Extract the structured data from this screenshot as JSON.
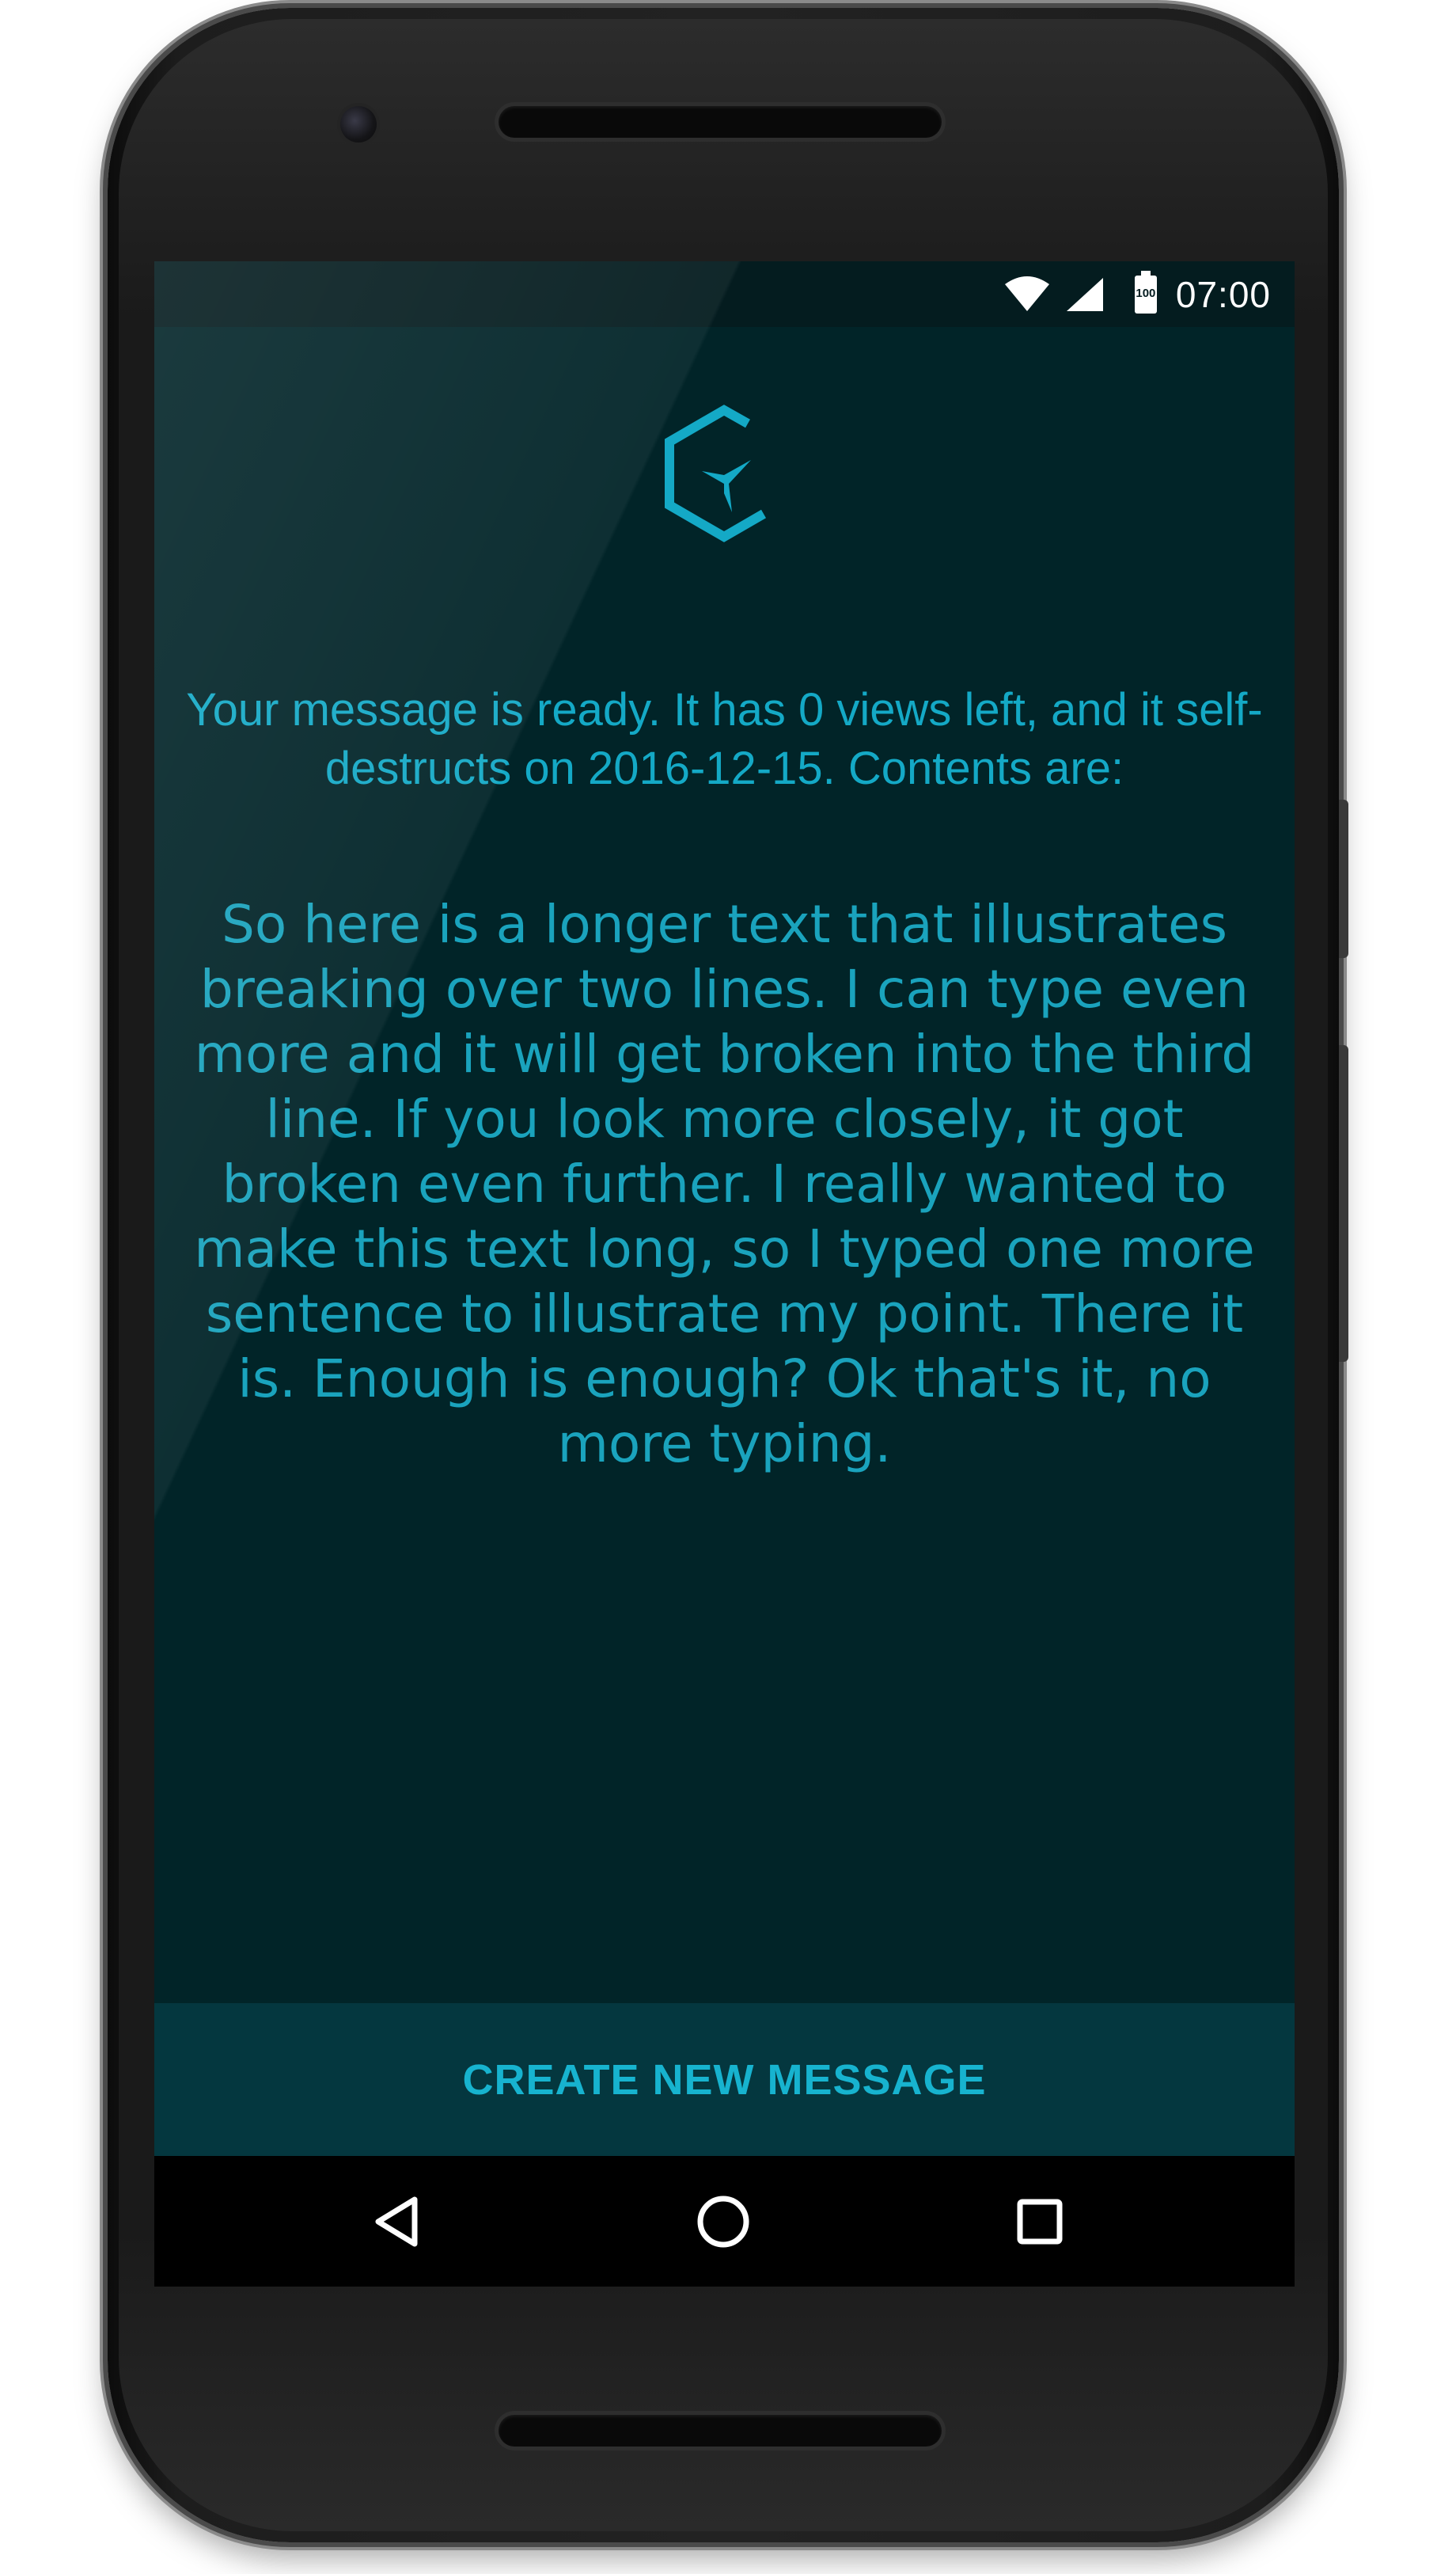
{
  "status_bar": {
    "time": "07:00",
    "battery_level": "100",
    "icons": [
      "wifi-icon",
      "signal-icon",
      "battery-icon"
    ]
  },
  "app": {
    "logo": "hexagon-logo-icon",
    "headline": "Your message is ready. It has 0 views left, and it self-destructs on 2016-12-15. Contents are:",
    "message_body": "So here is a longer text that illustrates breaking over two lines. I can type even more and it will get broken into the third line. If you look more closely, it got broken even further. I really wanted to make this text long, so I typed one more sentence to illustrate my point. There it is. Enough is enough? Ok that's it, no more typing.",
    "create_button_label": "CREATE NEW MESSAGE"
  },
  "nav_bar": {
    "items": [
      "back-icon",
      "home-icon",
      "recents-icon"
    ]
  },
  "colors": {
    "screen_bg": "#012428",
    "accent": "#14a9c6",
    "button_bg": "#04373f",
    "status_bar_bg": "#041c1f",
    "nav_bar_bg": "#000000"
  }
}
